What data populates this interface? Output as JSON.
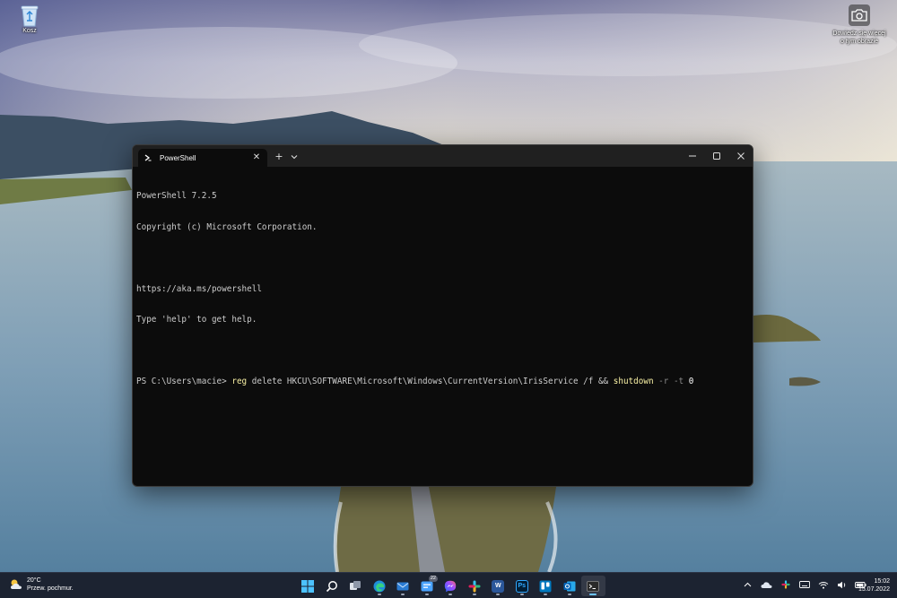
{
  "desktop": {
    "recycle_bin_label": "Kosz",
    "spotlight_label_line1": "Dowiedz się więcej",
    "spotlight_label_line2": "o tym obrazie"
  },
  "terminal": {
    "tab_title": "PowerShell",
    "tab_close_glyph": "✕",
    "new_tab_glyph": "+",
    "lines": [
      "PowerShell 7.2.5",
      "Copyright (c) Microsoft Corporation.",
      "",
      "https://aka.ms/powershell",
      "Type 'help' to get help.",
      ""
    ],
    "prompt": "PS C:\\Users\\macie> ",
    "cmd_reg": "reg",
    "cmd_args": " delete HKCU\\SOFTWARE\\Microsoft\\Windows\\CurrentVersion\\IrisService /f && ",
    "cmd_shutdown": "shutdown",
    "cmd_param_r": " -r",
    "cmd_param_t": " -t",
    "cmd_zero": " 0"
  },
  "taskbar": {
    "weather_temp": "20°C",
    "weather_desc": "Przew. pochmur.",
    "apps": [
      {
        "name": "start-button",
        "icon": "windows-logo-icon"
      },
      {
        "name": "search-button",
        "icon": "search-icon"
      },
      {
        "name": "task-view-button",
        "icon": "task-view-icon"
      },
      {
        "name": "edge-button",
        "icon": "edge-icon"
      },
      {
        "name": "mail-button",
        "icon": "mail-icon"
      },
      {
        "name": "teams-button",
        "icon": "chat-icon",
        "badge": "22"
      },
      {
        "name": "messenger-button",
        "icon": "messenger-icon"
      },
      {
        "name": "slack-button",
        "icon": "slack-icon"
      },
      {
        "name": "word-button",
        "icon": "word-icon",
        "label": "W"
      },
      {
        "name": "photoshop-button",
        "icon": "photoshop-icon",
        "label": "Ps"
      },
      {
        "name": "trello-button",
        "icon": "trello-icon"
      },
      {
        "name": "outlook-button",
        "icon": "outlook-icon"
      },
      {
        "name": "terminal-button",
        "icon": "terminal-icon"
      }
    ],
    "time": "15:02",
    "date": "15.07.2022"
  },
  "colors": {
    "terminal_bg": "#0c0c0c",
    "titlebar_bg": "#202020",
    "taskbar_bg": "#1c2331",
    "keyword_yellow": "#f9f1a5",
    "param_gray": "#8a8a8a"
  }
}
